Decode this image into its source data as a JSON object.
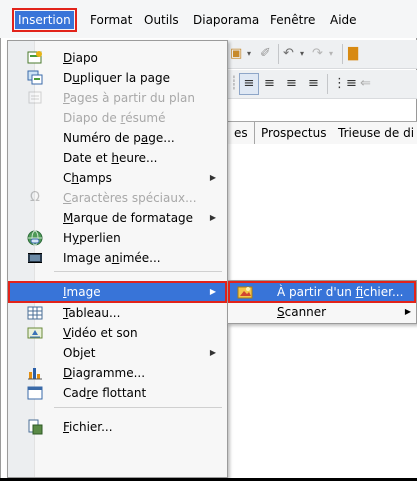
{
  "menubar": {
    "items": [
      "Insertion",
      "Format",
      "Outils",
      "Diaporama",
      "Fenêtre",
      "Aide"
    ],
    "active": "Insertion"
  },
  "toolbar": {
    "row1": [
      "▾",
      "▾",
      "▾",
      "▾"
    ],
    "row2": [
      "≡",
      "≡",
      "≡",
      "≡",
      "⋮≡",
      "⇐"
    ]
  },
  "tabs": [
    "es",
    "Prospectus",
    "Trieuse de di"
  ],
  "insert_menu": {
    "items": [
      {
        "label": "Diapo",
        "icon": "new-slide-icon",
        "disabled": false
      },
      {
        "label": "Dupliquer la page",
        "icon": "duplicate-slide-icon",
        "disabled": false
      },
      {
        "label": "Pages à partir du plan",
        "icon": "outline-pages-icon",
        "disabled": true
      },
      {
        "label": "Diapo de résumé",
        "icon": "",
        "disabled": true
      },
      {
        "label": "Numéro de page...",
        "icon": "",
        "disabled": false
      },
      {
        "label": "Date et heure...",
        "icon": "",
        "disabled": false
      },
      {
        "label": "Champs",
        "icon": "",
        "disabled": false,
        "submenu": true
      },
      {
        "label": "Caractères spéciaux...",
        "icon": "omega-icon",
        "disabled": true
      },
      {
        "label": "Marque de formatage",
        "icon": "",
        "disabled": false,
        "submenu": true
      },
      {
        "label": "Hyperlien",
        "icon": "hyperlink-globe-icon",
        "disabled": false
      },
      {
        "label": "Image animée...",
        "icon": "animated-image-icon",
        "disabled": false
      },
      {
        "label": "Image",
        "icon": "",
        "disabled": false,
        "submenu": true,
        "highlighted": true
      },
      {
        "label": "Tableau...",
        "icon": "table-icon",
        "disabled": false
      },
      {
        "label": "Vidéo et son",
        "icon": "media-icon",
        "disabled": false
      },
      {
        "label": "Objet",
        "icon": "",
        "disabled": false,
        "submenu": true
      },
      {
        "label": "Diagramme...",
        "icon": "bar-chart-icon",
        "disabled": false
      },
      {
        "label": "Cadre flottant",
        "icon": "frame-icon",
        "disabled": false
      },
      {
        "label": "Fichier...",
        "icon": "file-icon",
        "disabled": false
      }
    ]
  },
  "image_submenu": {
    "items": [
      {
        "label": "À partir d'un fichier...",
        "icon": "image-from-file-icon",
        "highlighted": true
      },
      {
        "label": "Scanner",
        "icon": "",
        "submenu": true
      }
    ]
  },
  "colors": {
    "highlight": "#3874d8",
    "annotation_red": "#e2231a"
  }
}
